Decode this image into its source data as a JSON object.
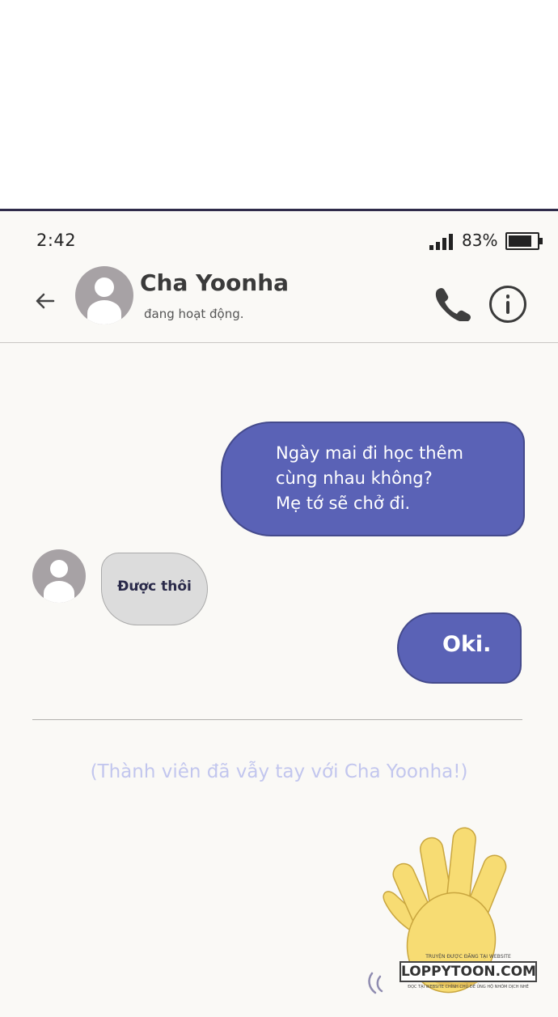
{
  "status_bar": {
    "time": "2:42",
    "battery_percent": "83%",
    "battery_level": 0.83
  },
  "header": {
    "contact_name": "Cha Yoonha",
    "contact_status": "đang hoạt động."
  },
  "icons": {
    "back": "arrow-left-icon",
    "phone": "phone-icon",
    "info": "info-icon",
    "avatar": "user-avatar-icon",
    "wave": "waving-hand-icon"
  },
  "messages": [
    {
      "sender": "me",
      "text": "Ngày mai đi học thêm\ncùng nhau không?\nMẹ tớ sẽ chở đi."
    },
    {
      "sender": "Cha Yoonha",
      "text": "Được thôi"
    },
    {
      "sender": "me",
      "text": "Oki."
    }
  ],
  "system_message": "(Thành viên đã vẫy tay với Cha Yoonha!)",
  "watermark": {
    "top": "TRUYỆN ĐƯỢC ĐĂNG TẠI WEBSITE",
    "main": "LOPPYTOON.COM",
    "bottom": "ĐỌC TẠI WEBSITE CHÍNH CHỦ ĐỂ ỦNG HỘ NHÓM DỊCH NHÉ"
  },
  "colors": {
    "outgoing_bubble": "#5a62b6",
    "incoming_bubble": "#dcdcdc",
    "system_text": "#c2c6ee",
    "background": "#faf9f6"
  }
}
